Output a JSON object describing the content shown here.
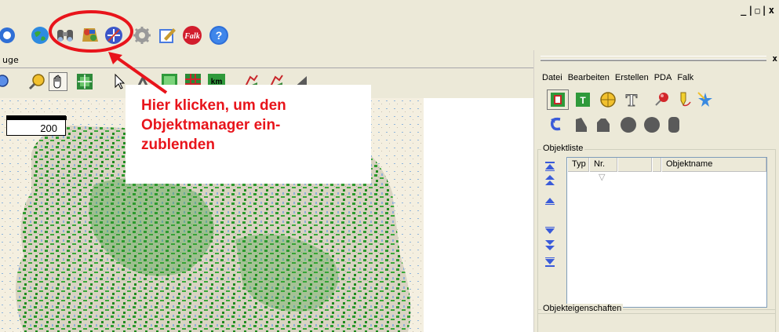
{
  "window": {
    "controls": "_|e|x"
  },
  "main_toolbar": {
    "icons": [
      "refresh-icon",
      "globe-icon",
      "binoculars-icon",
      "object-manager-icon",
      "route-icon",
      "gear-icon",
      "edit-icon",
      "falk-icon",
      "help-icon"
    ],
    "falk_label": "Falk"
  },
  "tools_label": "uge",
  "map_toolbar": {
    "icons": [
      "zoom-out-icon",
      "zoom-in-icon",
      "hand-icon",
      "fit-view-icon",
      "pointer-icon",
      "measure-icon",
      "grid-green-icon",
      "grid-red-icon",
      "km-icon",
      "route-a-icon",
      "route-b-icon",
      "route-c-icon"
    ],
    "km_label": "km"
  },
  "map": {
    "scale_value": "200"
  },
  "callout": {
    "line1": "Hier klicken, um den",
    "line2": "Objektmanager ein-",
    "line3": "zublenden",
    "color": "#e8141b"
  },
  "object_panel": {
    "close_label": "x",
    "menu": [
      "Datei",
      "Bearbeiten",
      "Erstellen",
      "PDA",
      "Falk"
    ],
    "object_list_label": "Objektliste",
    "columns": [
      "Typ",
      "Nr.",
      "",
      "Objektname"
    ],
    "properties_label": "Objekteigenschaften"
  },
  "colors": {
    "accent_red": "#e8141b",
    "face": "#ece9d8",
    "nav_blue": "#3a5bd9"
  }
}
